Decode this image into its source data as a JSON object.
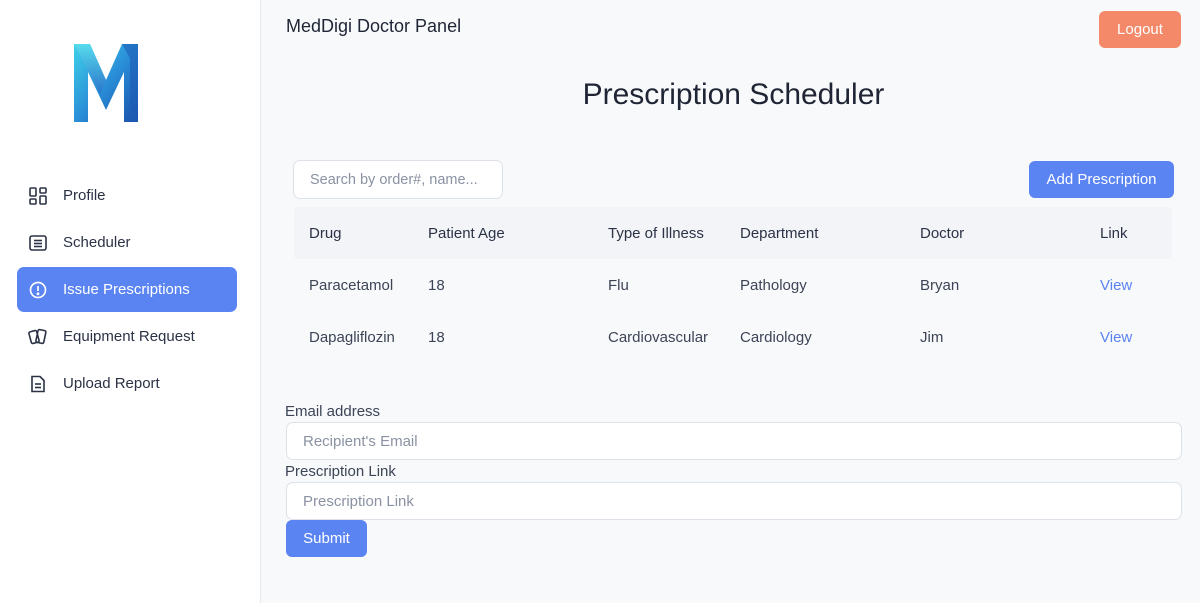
{
  "app": {
    "panel_title": "MedDigi Doctor Panel",
    "logout_label": "Logout"
  },
  "sidebar": {
    "items": [
      {
        "label": "Profile",
        "icon": "dashboard-grid-icon",
        "active": false
      },
      {
        "label": "Scheduler",
        "icon": "list-document-icon",
        "active": false
      },
      {
        "label": "Issue Prescriptions",
        "icon": "alert-circle-icon",
        "active": true
      },
      {
        "label": "Equipment Request",
        "icon": "cards-icon",
        "active": false
      },
      {
        "label": "Upload Report",
        "icon": "file-icon",
        "active": false
      }
    ]
  },
  "main": {
    "title": "Prescription Scheduler",
    "search_placeholder": "Search by order#, name...",
    "add_label": "Add Prescription"
  },
  "table": {
    "headers": [
      "Drug",
      "Patient Age",
      "Type of Illness",
      "Department",
      "Doctor",
      "Link"
    ],
    "rows": [
      {
        "drug": "Paracetamol",
        "age": "18",
        "illness": "Flu",
        "department": "Pathology",
        "doctor": "Bryan",
        "link": "View"
      },
      {
        "drug": "Dapagliflozin",
        "age": "18",
        "illness": "Cardiovascular",
        "department": "Cardiology",
        "doctor": "Jim",
        "link": "View"
      }
    ]
  },
  "form": {
    "email_label": "Email address",
    "email_placeholder": "Recipient's Email",
    "link_label": "Prescription Link",
    "link_placeholder": "Prescription Link",
    "submit_label": "Submit"
  },
  "colors": {
    "accent": "#5b84f3",
    "logout": "#f4896a",
    "background": "#f8f9fb"
  }
}
